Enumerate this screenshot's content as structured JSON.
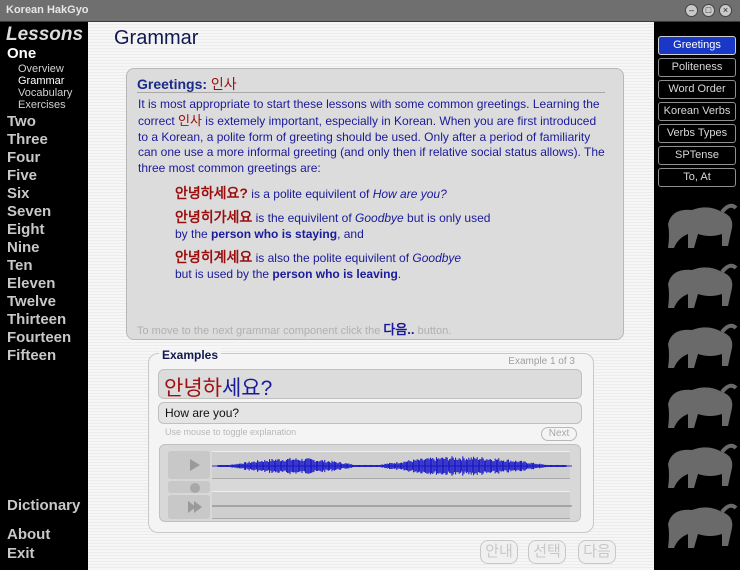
{
  "window": {
    "title": "Korean HakGyo"
  },
  "sidebar": {
    "heading": "Lessons",
    "lessons": [
      "One",
      "Two",
      "Three",
      "Four",
      "Five",
      "Six",
      "Seven",
      "Eight",
      "Nine",
      "Ten",
      "Eleven",
      "Twelve",
      "Thirteen",
      "Fourteen",
      "Fifteen"
    ],
    "subitems": [
      "Overview",
      "Grammar",
      "Vocabulary",
      "Exercises"
    ],
    "dictionary": "Dictionary",
    "about": "About",
    "exit": "Exit"
  },
  "page": {
    "title": "Grammar"
  },
  "grammar": {
    "heading": "Greetings:",
    "heading_kr": "인사",
    "para_1": "It is most appropriate to start these lessons with some common greetings. Learning the correct ",
    "para_kr": "인사",
    "para_2": " is extemely important, especially in Korean.  When you are first introduced to a Korean, a polite form of greeting should be used. Only after a period of familiarity can one use a more informal greeting (and only then if relative social status allows). The three most common greetings are:",
    "greetings": [
      {
        "kr": "안녕하세요?",
        "t1": " is a polite equivilent of ",
        "i1": "How are you?",
        "t2": "",
        "b1": "",
        "t3": ""
      },
      {
        "kr": "안녕히가세요",
        "t1": " is the equivilent of ",
        "i1": "Goodbye",
        "t2": " but is only used by the ",
        "b1": "person who is staying",
        "t3": ", and"
      },
      {
        "kr": "안녕히계세요",
        "t1": " is also the polite equivilent of ",
        "i1": "Goodbye",
        "t2": " but is used by the ",
        "b1": "person who is leaving",
        "t3": "."
      }
    ],
    "next_hint_1": "To move to the next grammar component click the ",
    "next_hint_kr": "다음..",
    "next_hint_2": " button."
  },
  "examples": {
    "label": "Examples",
    "count": "Example 1 of 3",
    "korean_red": "안녕",
    "korean_mid": "하",
    "korean_rest": "세요?",
    "english": "How are you?",
    "hint": "Use mouse to toggle explanation",
    "next_label": "Next"
  },
  "bottom_buttons": {
    "guide": "안내",
    "select": "선택",
    "next": "다음"
  },
  "right_nav": {
    "items": [
      "Greetings",
      "Politeness",
      "Word Order",
      "Korean Verbs",
      "Verbs Types",
      "SPTense",
      "To, At"
    ],
    "active": "Greetings"
  },
  "colors": {
    "accent": "#1a38c8",
    "text_blue": "#1a1a9a",
    "korean_red": "#9a0e0e",
    "waveform": "#1010c8"
  },
  "icons": [
    "minimize-icon",
    "maximize-icon",
    "close-icon",
    "play-icon",
    "record-icon",
    "playback-icon",
    "tiger-icon"
  ]
}
